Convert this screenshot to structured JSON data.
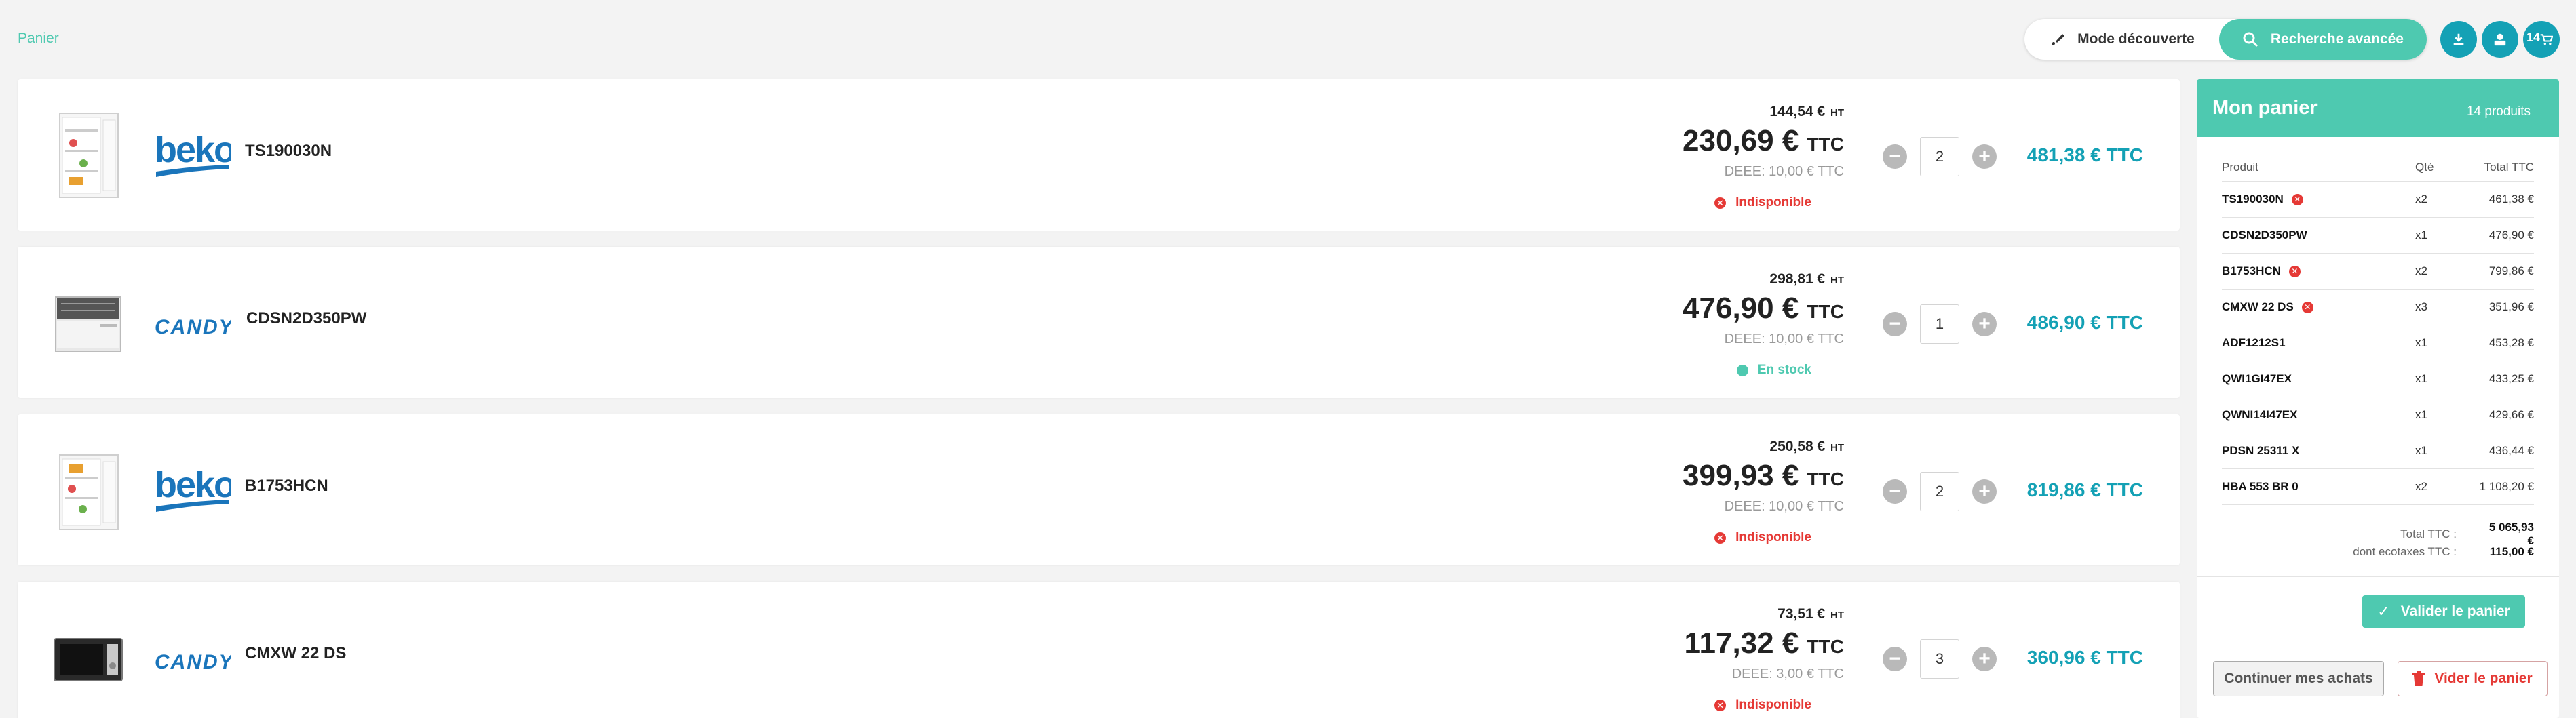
{
  "breadcrumb": "Panier",
  "topbar": {
    "mode_label": "Mode découverte",
    "search_label": "Recherche avancée",
    "cart_count": "14",
    "accent": "#14a1b5",
    "teal": "#4ec9b0"
  },
  "items": [
    {
      "model": "TS190030N",
      "brand": "beko",
      "price_ht": "144,54 €",
      "ht_unit": "HT",
      "price_ttc": "230,69 €",
      "ttc_unit": "TTC",
      "deee": "DEEE: 10,00 € TTC",
      "status": "Indisponible",
      "status_type": "unavailable",
      "qty": "2",
      "total": "481,38 € TTC",
      "image_icon": "fridge-icon"
    },
    {
      "model": "CDSN2D350PW",
      "brand": "candy",
      "price_ht": "298,81 €",
      "ht_unit": "HT",
      "price_ttc": "476,90 €",
      "ttc_unit": "TTC",
      "deee": "DEEE: 10,00 € TTC",
      "status": "En stock",
      "status_type": "in-stock",
      "qty": "1",
      "total": "486,90 € TTC",
      "image_icon": "dishwasher-icon"
    },
    {
      "model": "B1753HCN",
      "brand": "beko",
      "price_ht": "250,58 €",
      "ht_unit": "HT",
      "price_ttc": "399,93 €",
      "ttc_unit": "TTC",
      "deee": "DEEE: 10,00 € TTC",
      "status": "Indisponible",
      "status_type": "unavailable",
      "qty": "2",
      "total": "819,86 € TTC",
      "image_icon": "fridge-icon"
    },
    {
      "model": "CMXW 22 DS",
      "brand": "candy",
      "price_ht": "73,51 €",
      "ht_unit": "HT",
      "price_ttc": "117,32 €",
      "ttc_unit": "TTC",
      "deee": "DEEE: 3,00 € TTC",
      "status": "Indisponible",
      "status_type": "unavailable",
      "qty": "3",
      "total": "360,96 € TTC",
      "image_icon": "microwave-icon"
    }
  ],
  "summary": {
    "title": "Mon panier",
    "count": "14 produits",
    "col_product": "Produit",
    "col_qty": "Qté",
    "col_total": "Total TTC",
    "rows": [
      {
        "product": "TS190030N",
        "qty": "x2",
        "total": "461,38 €",
        "unavailable": true
      },
      {
        "product": "CDSN2D350PW",
        "qty": "x1",
        "total": "476,90 €",
        "unavailable": false
      },
      {
        "product": "B1753HCN",
        "qty": "x2",
        "total": "799,86 €",
        "unavailable": true
      },
      {
        "product": "CMXW 22 DS",
        "qty": "x3",
        "total": "351,96 €",
        "unavailable": true
      },
      {
        "product": "ADF1212S1",
        "qty": "x1",
        "total": "453,28 €",
        "unavailable": false
      },
      {
        "product": "QWI1GI47EX",
        "qty": "x1",
        "total": "433,25 €",
        "unavailable": false
      },
      {
        "product": "QWNI14I47EX",
        "qty": "x1",
        "total": "429,66 €",
        "unavailable": false
      },
      {
        "product": "PDSN 25311 X",
        "qty": "x1",
        "total": "436,44 €",
        "unavailable": false
      },
      {
        "product": "HBA 553 BR 0",
        "qty": "x2",
        "total": "1 108,20 €",
        "unavailable": false
      }
    ],
    "total_label": "Total TTC :",
    "total_value": "5 065,93 €",
    "eco_label": "dont ecotaxes TTC :",
    "eco_value": "115,00 €",
    "validate_label": "Valider le panier",
    "continue_label": "Continuer mes achats",
    "empty_label": "Vider le panier"
  }
}
